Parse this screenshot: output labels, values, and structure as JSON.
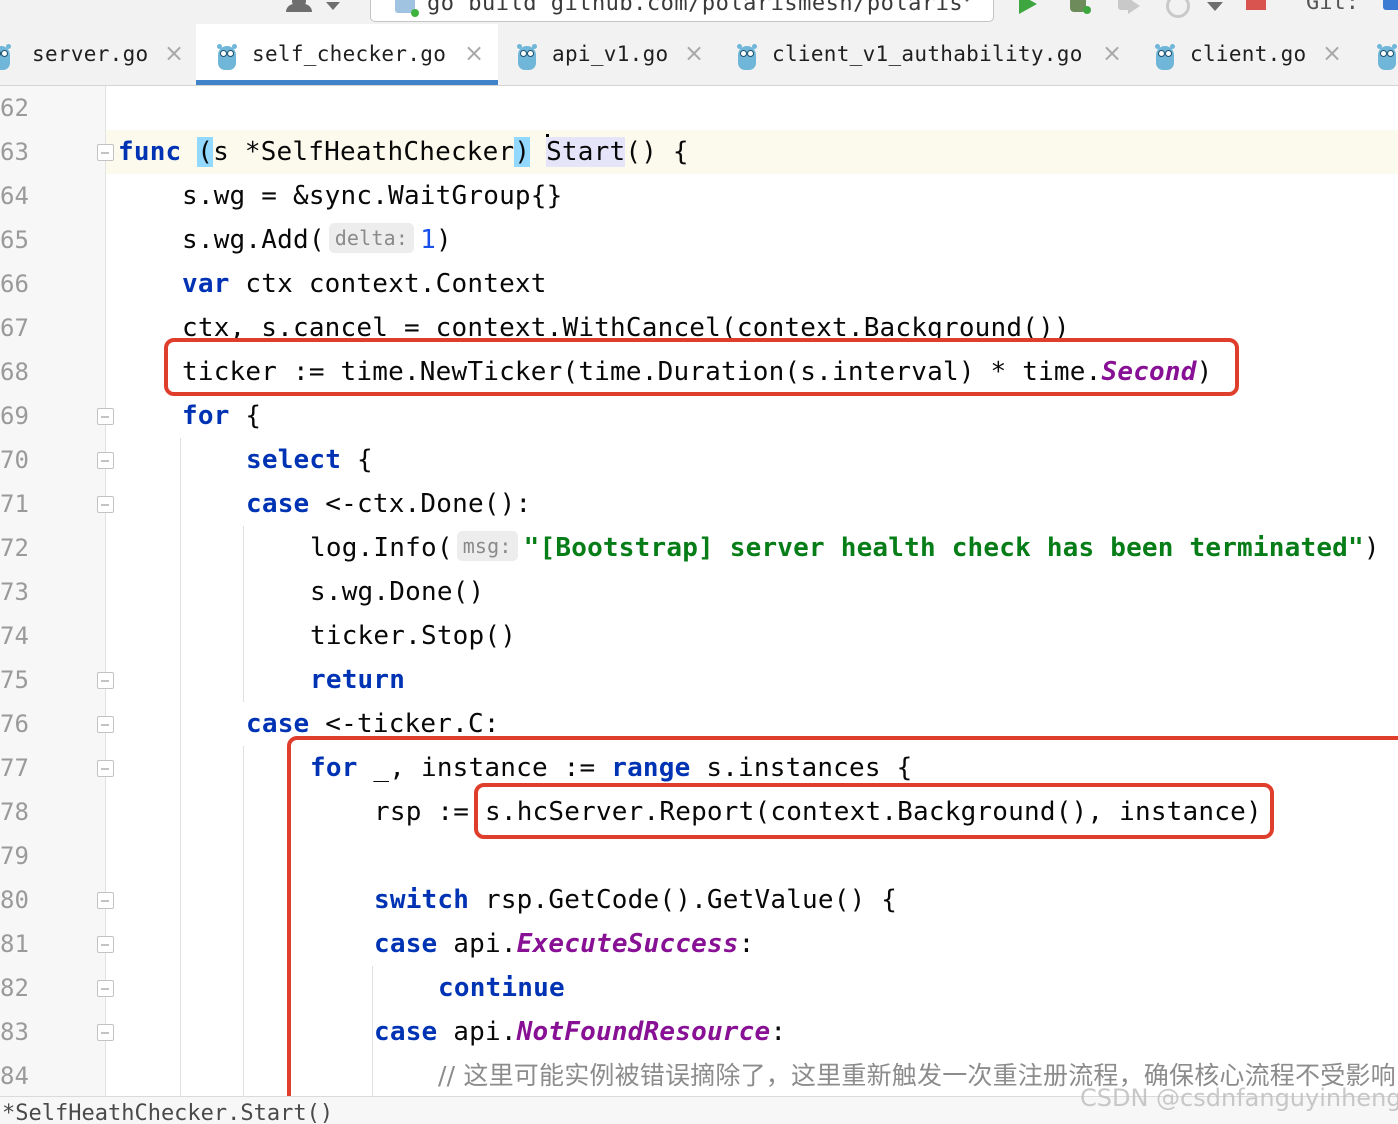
{
  "toolbar": {
    "run_config": "go build github.com/polarismesh/polaris",
    "git_label": "Git:"
  },
  "tabs": [
    {
      "label": "server.go"
    },
    {
      "label": "self_checker.go"
    },
    {
      "label": "api_v1.go"
    },
    {
      "label": "client_v1_authability.go"
    },
    {
      "label": "client.go"
    }
  ],
  "tab_close_glyph": "×",
  "active_tab": "self_checker.go",
  "editor": {
    "line_numbers": [
      "62",
      "63",
      "64",
      "65",
      "66",
      "67",
      "68",
      "69",
      "70",
      "71",
      "72",
      "73",
      "74",
      "75",
      "76",
      "77",
      "78",
      "79",
      "80",
      "81",
      "82",
      "83",
      "84"
    ],
    "hints": {
      "delta": "delta:",
      "msg": "msg:"
    },
    "code": {
      "l63_func": "func",
      "l63_recv_open": "(",
      "l63_recv": "s *SelfHeathChecker",
      "l63_recv_close": ")",
      "l63_name": "Start",
      "l63_rest": "() {",
      "l64": "s.wg = &sync.WaitGroup{}",
      "l65_pre": "s.wg.Add(",
      "l65_num": "1",
      "l65_post": ")",
      "l66_kw": "var",
      "l66_rest": " ctx context.Context",
      "l67": "ctx, s.cancel = context.WithCancel(context.Background())",
      "l68_pre": "ticker := time.NewTicker(time.Duration(s.interval) * time.",
      "l68_const": "Second",
      "l68_post": ")",
      "l69_kw": "for",
      "l69_rest": " {",
      "l70_kw": "select",
      "l70_rest": " {",
      "l71_kw": "case",
      "l71_rest": " <-ctx.Done():",
      "l72_pre": "log.Info(",
      "l72_str": "\"[Bootstrap] server health check has been terminated\"",
      "l72_post": ")",
      "l73": "s.wg.Done()",
      "l74": "ticker.Stop()",
      "l75_kw": "return",
      "l76_kw": "case",
      "l76_rest": " <-ticker.C:",
      "l77_kw1": "for",
      "l77_mid": " _, instance := ",
      "l77_kw2": "range",
      "l77_rest": " s.instances {",
      "l78_pre": "rsp := ",
      "l78_call": "s.hcServer.Report(context.Background(), instance)",
      "l80_kw": "switch",
      "l80_rest": " rsp.GetCode().GetValue() {",
      "l81_kw": "case",
      "l81_pre": " api.",
      "l81_const": "ExecuteSuccess",
      "l81_post": ":",
      "l82_kw": "continue",
      "l83_kw": "case",
      "l83_pre": " api.",
      "l83_const": "NotFoundResource",
      "l83_post": ":",
      "l84_comment": "// 这里可能实例被错误摘除了，这里重新触发一次重注册流程，确保核心流程不受影响"
    }
  },
  "breadcrumb": "*SelfHeathChecker.Start()",
  "watermark": "CSDN @csdnfanguyinheng",
  "colors": {
    "keyword": "#0033b3",
    "string": "#067d17",
    "constant": "#871094",
    "number": "#1750eb",
    "annotation_box": "#e03e2d",
    "active_tab_underline": "#4083c9"
  }
}
